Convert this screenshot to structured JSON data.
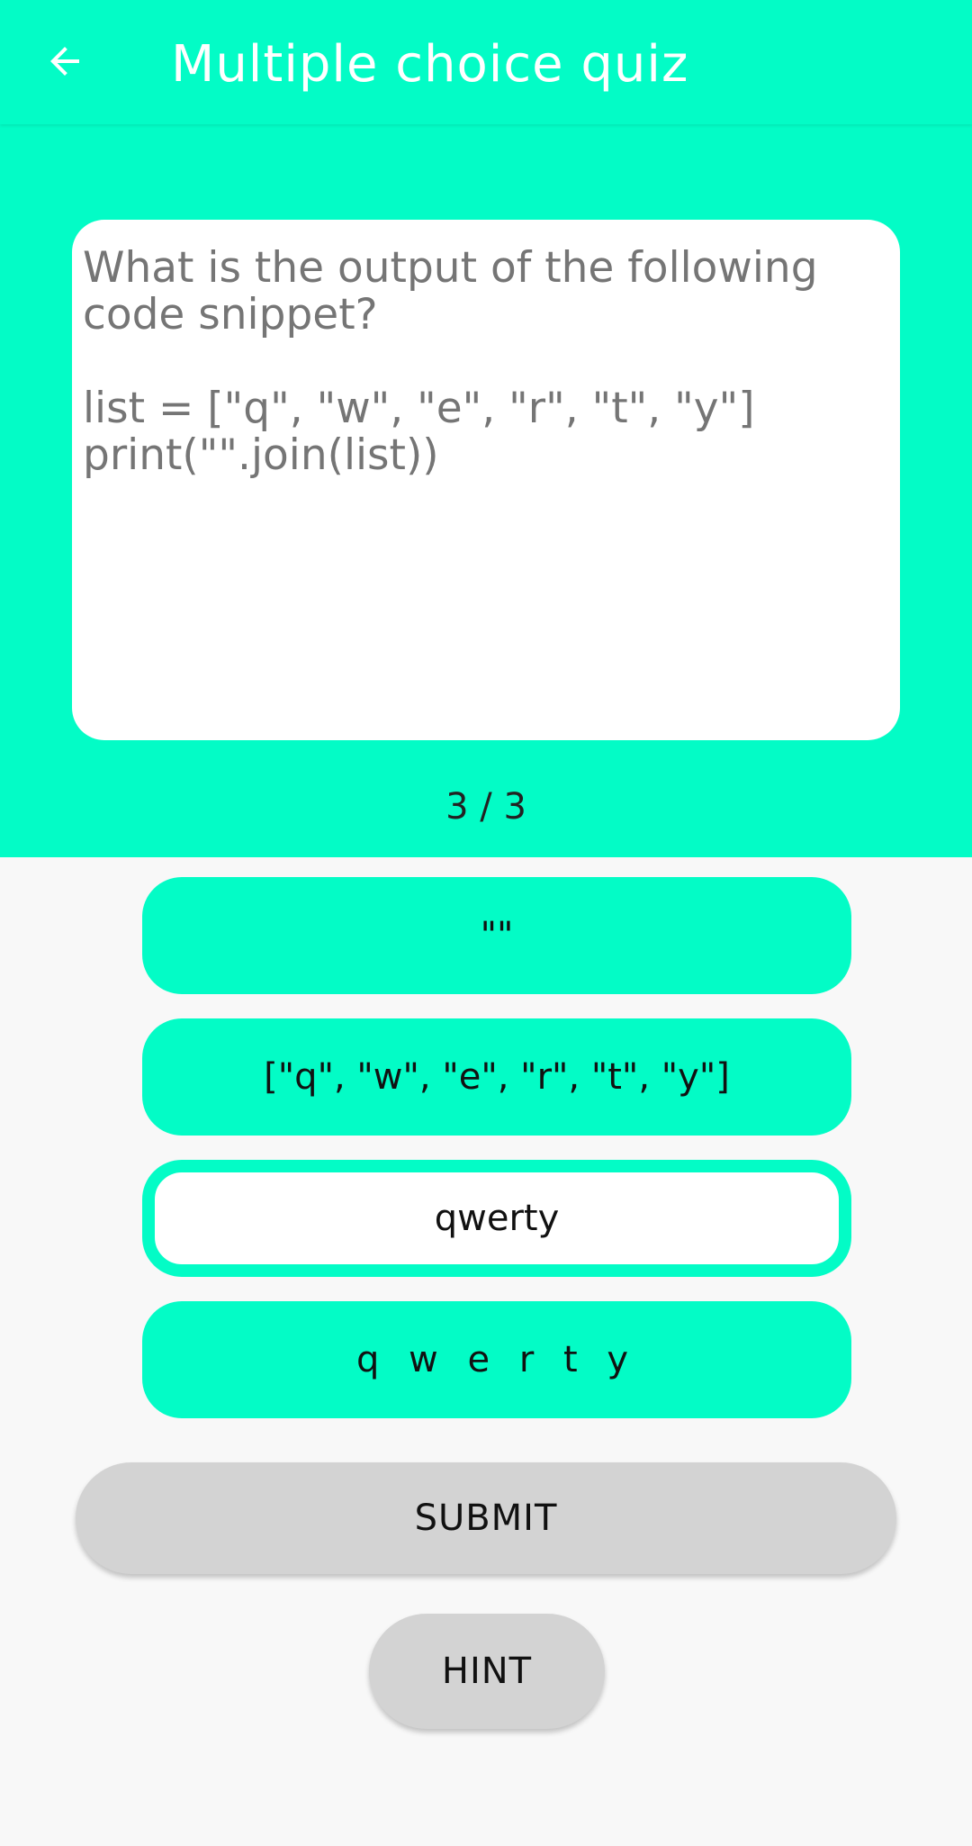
{
  "app_bar": {
    "back_icon": "arrow-left-icon",
    "title": "Multiple choice quiz"
  },
  "question": {
    "text": "What is the output of the following\ncode snippet?\n\nlist = [\"q\", \"w\", \"e\", \"r\", \"t\", \"y\"]\nprint(\"\".join(list))",
    "progress": "3 / 3"
  },
  "options": [
    {
      "label": "\"\"",
      "selected": false
    },
    {
      "label": "[\"q\", \"w\", \"e\", \"r\", \"t\", \"y\"]",
      "selected": false
    },
    {
      "label": "qwerty",
      "selected": true
    },
    {
      "label": "q w e r t y",
      "selected": false
    }
  ],
  "actions": {
    "submit_label": "SUBMIT",
    "hint_label": "HINT"
  },
  "colors": {
    "accent": "#03fcc6",
    "button_gray": "#d3d3d3",
    "background": "#f8f8f8",
    "question_text": "#757575"
  }
}
